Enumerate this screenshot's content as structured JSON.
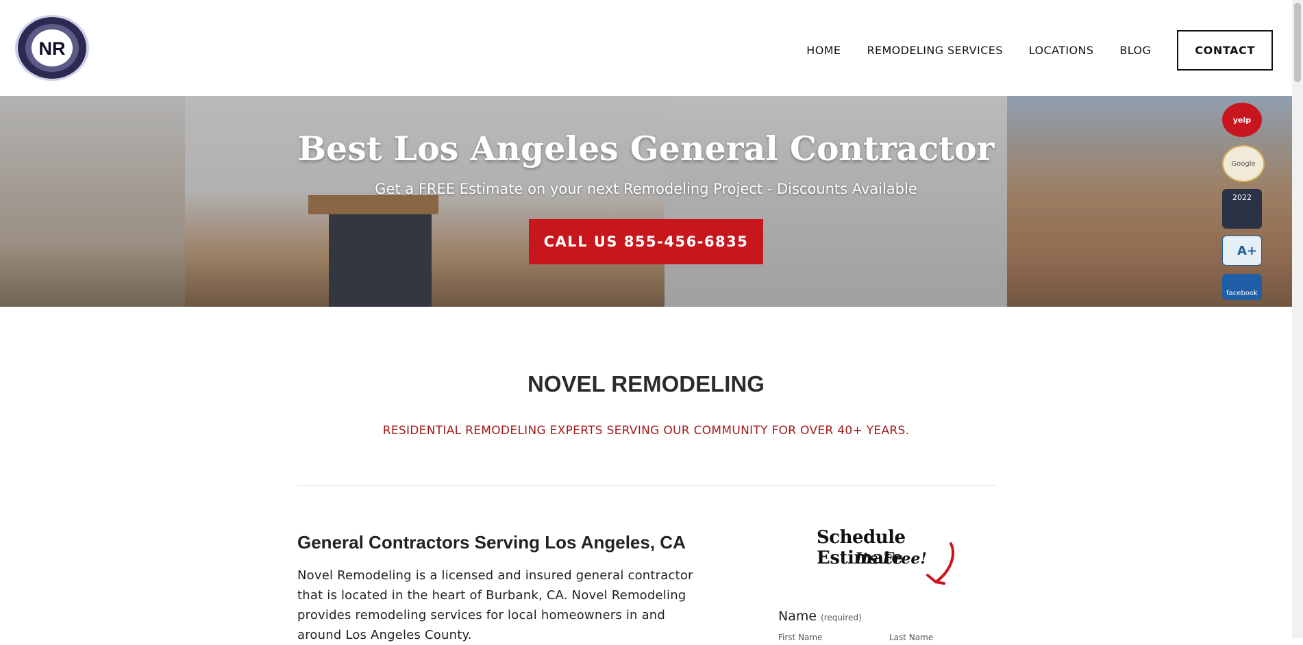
{
  "header": {
    "logo_text": "NR",
    "nav": [
      "HOME",
      "REMODELING SERVICES",
      "LOCATIONS",
      "BLOG"
    ],
    "contact_label": "CONTACT"
  },
  "hero": {
    "title": "Best Los Angeles General Contractor",
    "subtitle": "Get a FREE Estimate on your next Remodeling Project - Discounts Available",
    "cta": "CALL US 855-456-6835",
    "badges": [
      {
        "icon": "yelp-badge-icon",
        "text": "yelp"
      },
      {
        "icon": "google-badge-icon",
        "text": "Google"
      },
      {
        "icon": "houzz-badge-icon",
        "text": "2022"
      },
      {
        "icon": "bbb-badge-icon",
        "text": "A+"
      },
      {
        "icon": "facebook-badge-icon",
        "text": "facebook"
      }
    ]
  },
  "main": {
    "title": "NOVEL REMODELING",
    "tagline": "RESIDENTIAL REMODELING EXPERTS SERVING OUR COMMUNITY FOR OVER 40+ YEARS.",
    "heading": "General Contractors Serving Los Angeles, CA",
    "body": "Novel Remodeling is a licensed and insured general contractor that is located in the heart of Burbank, CA. Novel Remodeling provides remodeling services for local homeowners in and around Los Angeles County."
  },
  "form": {
    "schedule_title": "Schedule Estimate",
    "schedule_sub": "Its Free!",
    "name_label": "Name",
    "name_required": "(required)",
    "first_name": "First Name",
    "last_name": "Last Name"
  },
  "colors": {
    "accent": "#c8161d",
    "tagline": "#a31a1a"
  }
}
